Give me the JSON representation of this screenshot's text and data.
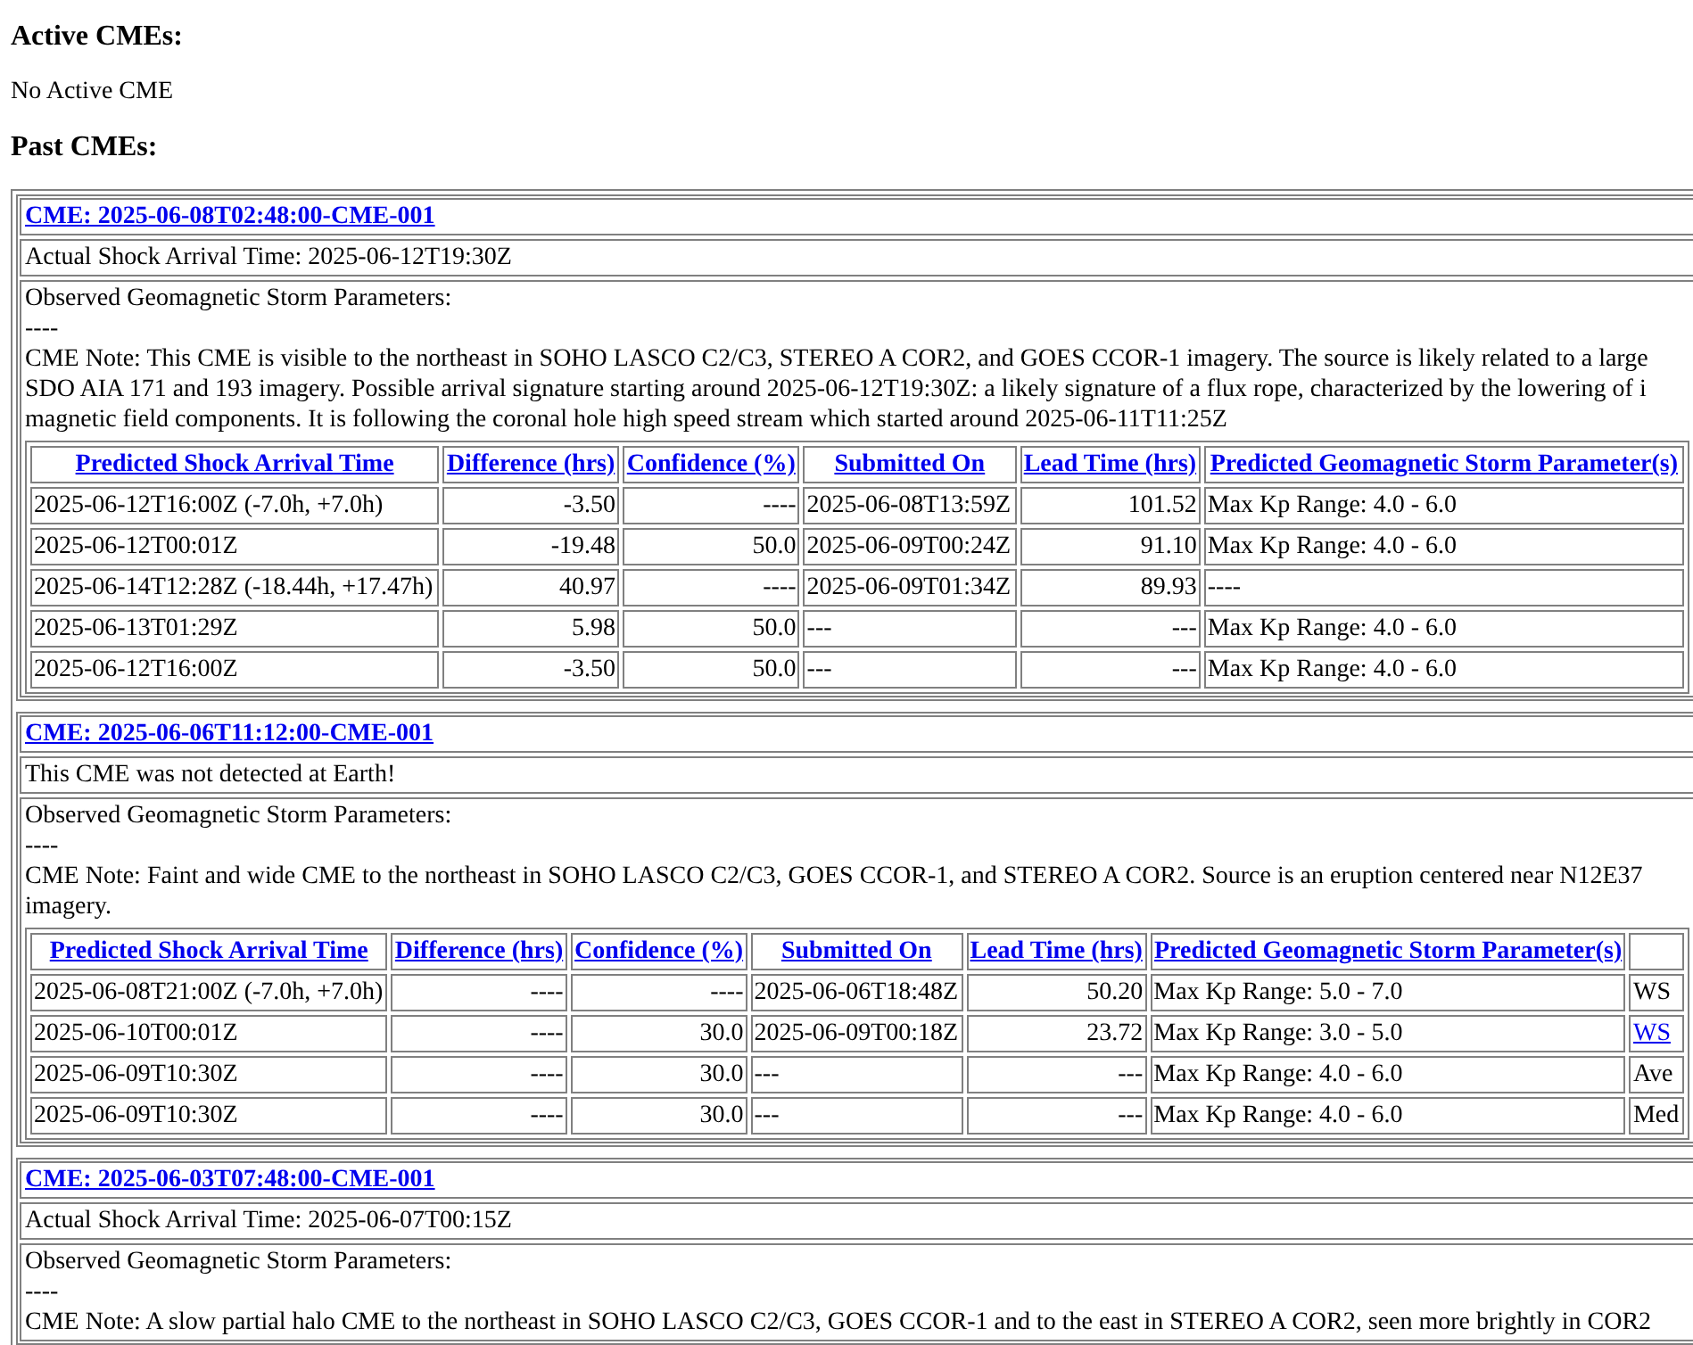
{
  "active": {
    "heading": "Active CMEs:",
    "message": "No Active CME"
  },
  "past": {
    "heading": "Past CMEs:",
    "cmes": [
      {
        "title": "CME: 2025-06-08T02:48:00-CME-001",
        "status": "Actual Shock Arrival Time: 2025-06-12T19:30Z",
        "observed_label": "Observed Geomagnetic Storm Parameters:",
        "observed_value": "----",
        "note_lines": [
          "CME Note: This CME is visible to the northeast in SOHO LASCO C2/C3, STEREO A COR2, and GOES CCOR-1 imagery. The source is likely related to a large",
          "SDO AIA 171 and 193 imagery. Possible arrival signature starting around 2025-06-12T19:30Z: a likely signature of a flux rope, characterized by the lowering of i",
          "magnetic field components. It is following the coronal hole high speed stream which started around 2025-06-11T11:25Z"
        ],
        "table": {
          "columns": [
            "Predicted Shock Arrival Time",
            "Difference (hrs)",
            "Confidence (%)",
            "Submitted On",
            "Lead Time (hrs)",
            "Predicted Geomagnetic Storm Parameter(s)"
          ],
          "rows": [
            [
              "2025-06-12T16:00Z (-7.0h, +7.0h)",
              "-3.50",
              "----",
              "2025-06-08T13:59Z",
              "101.52",
              "Max Kp Range: 4.0 - 6.0"
            ],
            [
              "2025-06-12T00:01Z",
              "-19.48",
              "50.0",
              "2025-06-09T00:24Z",
              "91.10",
              "Max Kp Range: 4.0 - 6.0"
            ],
            [
              "2025-06-14T12:28Z (-18.44h, +17.47h)",
              "40.97",
              "----",
              "2025-06-09T01:34Z",
              "89.93",
              "----"
            ],
            [
              "2025-06-13T01:29Z",
              "5.98",
              "50.0",
              "---",
              "---",
              "Max Kp Range: 4.0 - 6.0"
            ],
            [
              "2025-06-12T16:00Z",
              "-3.50",
              "50.0",
              "---",
              "---",
              "Max Kp Range: 4.0 - 6.0"
            ]
          ]
        }
      },
      {
        "title": "CME: 2025-06-06T11:12:00-CME-001",
        "status": "This CME was not detected at Earth!",
        "observed_label": "Observed Geomagnetic Storm Parameters:",
        "observed_value": "----",
        "note_lines": [
          "CME Note: Faint and wide CME to the northeast in SOHO LASCO C2/C3, GOES CCOR-1, and STEREO A COR2. Source is an eruption centered near N12E37",
          "imagery."
        ],
        "table": {
          "columns": [
            "Predicted Shock Arrival Time",
            "Difference (hrs)",
            "Confidence (%)",
            "Submitted On",
            "Lead Time (hrs)",
            "Predicted Geomagnetic Storm Parameter(s)"
          ],
          "rows": [
            [
              "2025-06-08T21:00Z (-7.0h, +7.0h)",
              "----",
              "----",
              "2025-06-06T18:48Z",
              "50.20",
              "Max Kp Range: 5.0 - 7.0",
              "WS"
            ],
            [
              "2025-06-10T00:01Z",
              "----",
              "30.0",
              "2025-06-09T00:18Z",
              "23.72",
              "Max Kp Range: 3.0 - 5.0",
              {
                "link": "WS"
              }
            ],
            [
              "2025-06-09T10:30Z",
              "----",
              "30.0",
              "---",
              "---",
              "Max Kp Range: 4.0 - 6.0",
              "Ave"
            ],
            [
              "2025-06-09T10:30Z",
              "----",
              "30.0",
              "---",
              "---",
              "Max Kp Range: 4.0 - 6.0",
              "Med"
            ]
          ]
        }
      },
      {
        "title": "CME: 2025-06-03T07:48:00-CME-001",
        "status": "Actual Shock Arrival Time: 2025-06-07T00:15Z",
        "observed_label": "Observed Geomagnetic Storm Parameters:",
        "observed_value": "----",
        "note_lines": [
          "CME Note: A slow partial halo CME to the northeast in SOHO LASCO C2/C3, GOES CCOR-1 and to the east in STEREO A COR2, seen more brightly in COR2"
        ]
      }
    ]
  }
}
